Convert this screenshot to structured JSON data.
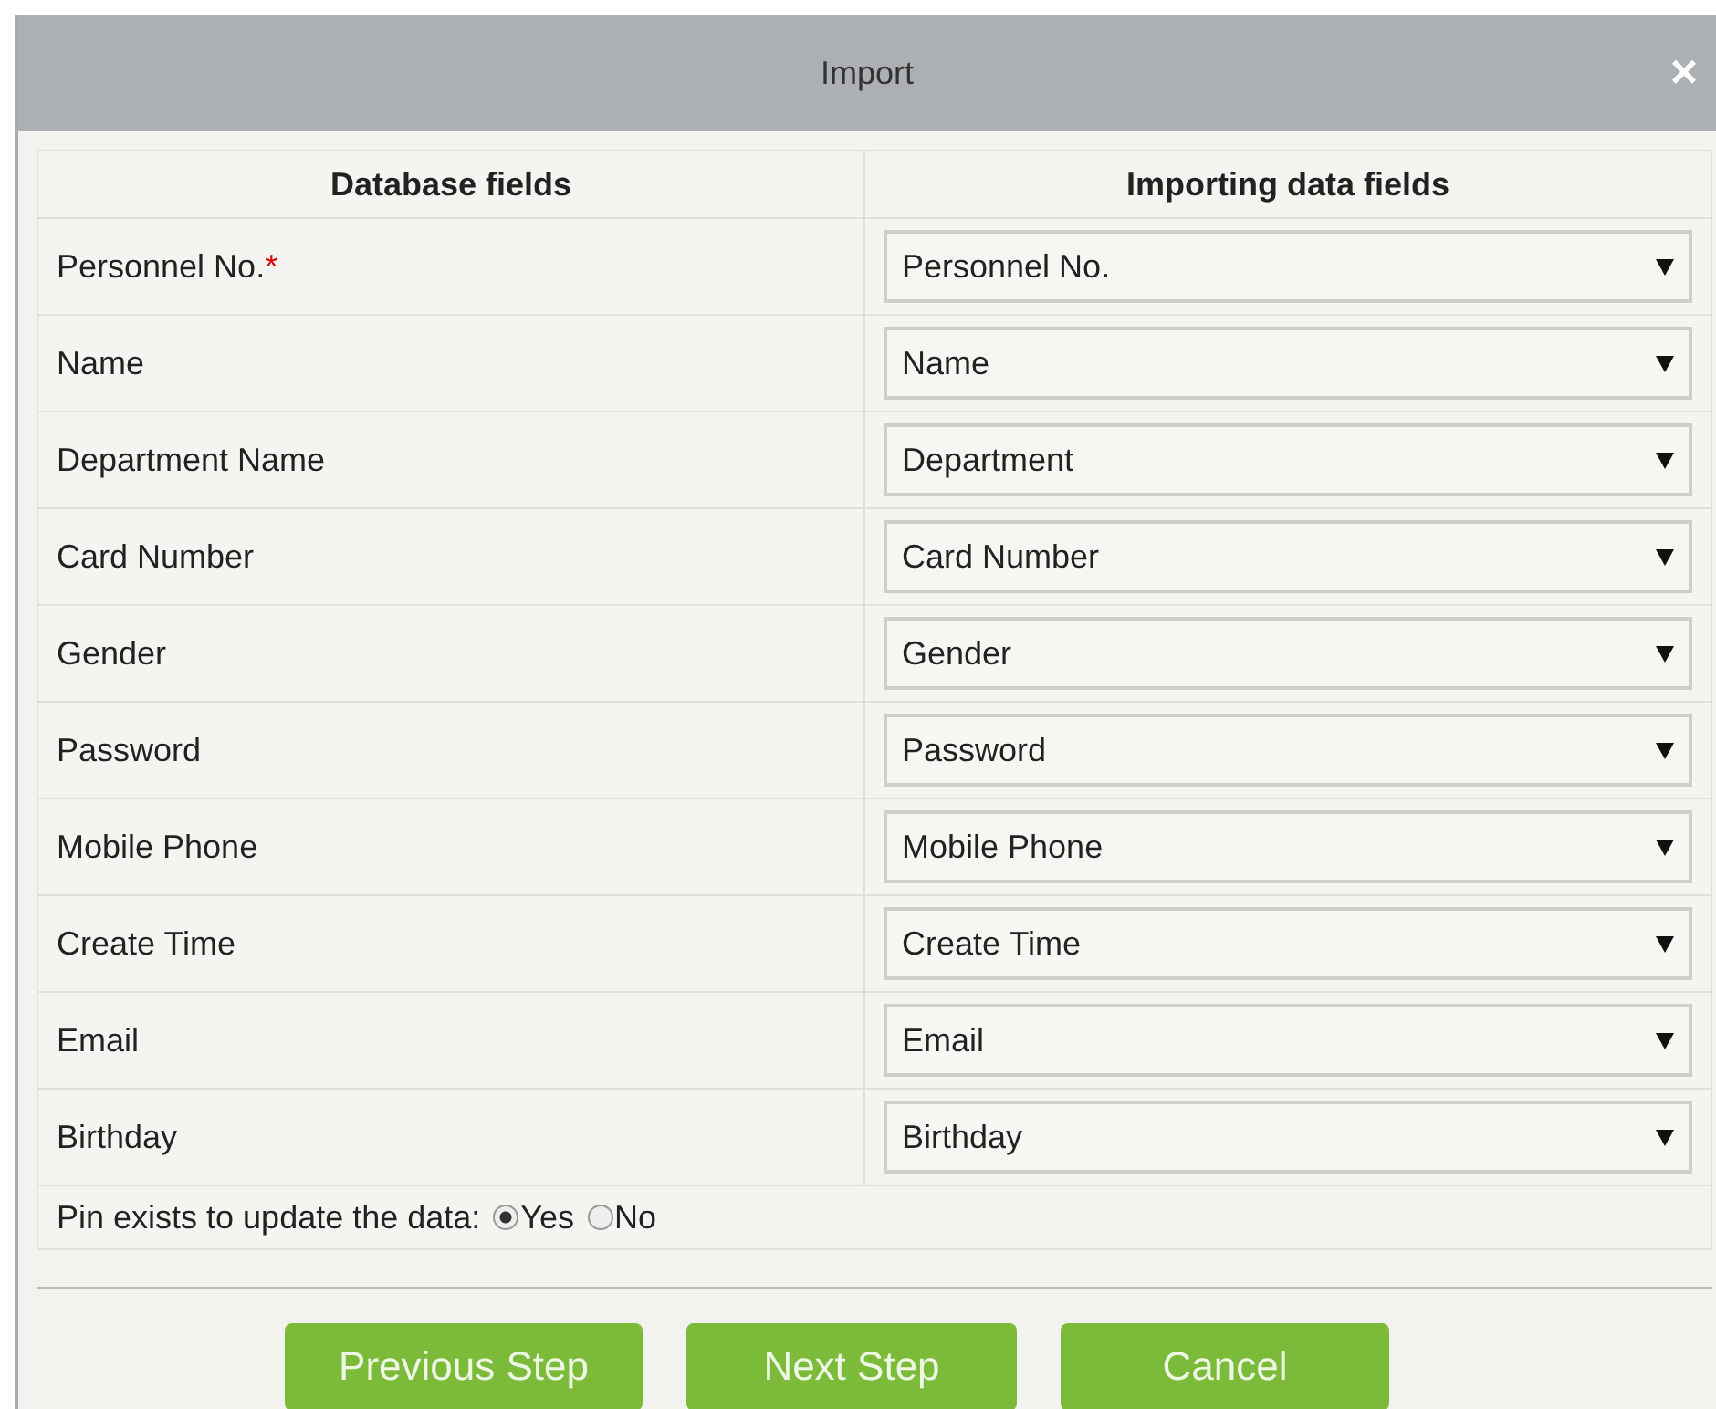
{
  "window": {
    "title": "Import",
    "close": "×"
  },
  "table": {
    "columns": [
      "Database fields",
      "Importing data fields"
    ],
    "rows": [
      {
        "field": "Personnel No.",
        "required_mark": "*",
        "value": "Personnel No."
      },
      {
        "field": "Name",
        "value": "Name"
      },
      {
        "field": "Department Name",
        "value": "Department"
      },
      {
        "field": "Card Number",
        "value": "Card Number"
      },
      {
        "field": "Gender",
        "value": "Gender"
      },
      {
        "field": "Password",
        "value": "Password"
      },
      {
        "field": "Mobile Phone",
        "value": "Mobile Phone"
      },
      {
        "field": "Create Time",
        "value": "Create Time"
      },
      {
        "field": "Email",
        "value": "Email"
      },
      {
        "field": "Birthday",
        "value": "Birthday"
      }
    ]
  },
  "update_option": {
    "label": "Pin exists to update the data:",
    "options": [
      {
        "label": "Yes",
        "selected": true
      },
      {
        "label": "No",
        "selected": false
      }
    ]
  },
  "buttons": [
    "Previous Step",
    "Next Step",
    "Cancel"
  ]
}
